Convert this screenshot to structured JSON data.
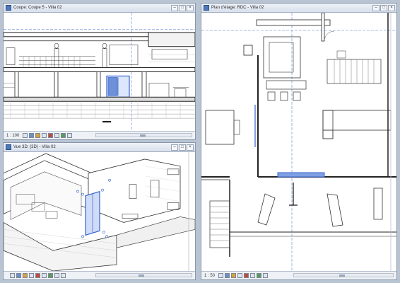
{
  "windows": {
    "section": {
      "title": "Coupe: Coupe 5 - Villa 02",
      "scale": "1 : 100",
      "buttons": {
        "minimize": "–",
        "maximize": "□",
        "close": "×"
      }
    },
    "view3d": {
      "title": "Vue 3D: {3D} - Villa 02",
      "scale": "",
      "buttons": {
        "minimize": "–",
        "maximize": "□",
        "close": "×"
      }
    },
    "plan": {
      "title": "Plan d'étage: RDC - Villa 02",
      "scale": "1 : 50",
      "buttons": {
        "minimize": "–",
        "maximize": "□",
        "close": "×"
      }
    }
  },
  "colors": {
    "selection": "#3563c9",
    "workspace": "#b9c4d3",
    "titlebar": "#dde4ee"
  },
  "status_icons": [
    "detail-level-icon",
    "visual-style-icon",
    "sun-path-icon",
    "shadows-icon",
    "crop-icon",
    "show-crop-icon",
    "temporary-hide-icon",
    "reveal-hidden-icon",
    "analytical-icon"
  ]
}
